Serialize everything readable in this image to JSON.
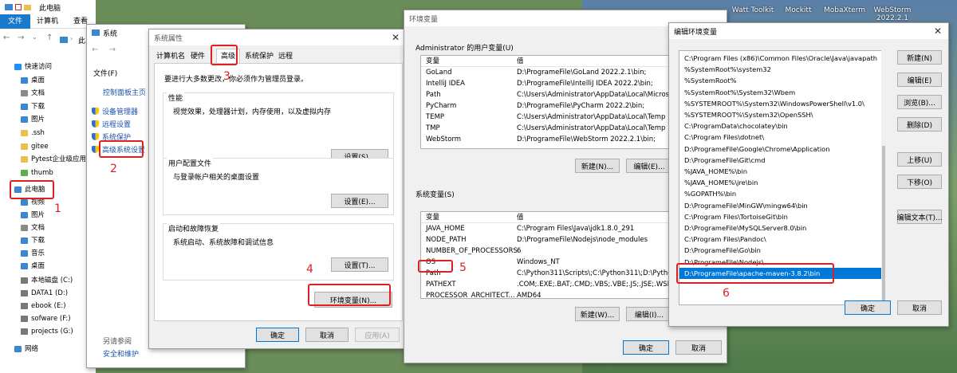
{
  "explorer": {
    "title": "此电脑",
    "ribbon_tabs": [
      "文件",
      "计算机",
      "查看"
    ],
    "nav_label": "此",
    "sidebar": [
      {
        "label": "快速访问",
        "icon": "star-icon",
        "color": "#1e90ff"
      },
      {
        "label": "桌面",
        "icon": "folder-icon",
        "color": "#3a86d0"
      },
      {
        "label": "文档",
        "icon": "document-icon",
        "color": "#8a8a8a"
      },
      {
        "label": "下载",
        "icon": "download-icon",
        "color": "#3a86d0"
      },
      {
        "label": "图片",
        "icon": "picture-icon",
        "color": "#3a86d0"
      },
      {
        "label": ".ssh",
        "icon": "folder-icon",
        "color": "#e8c04a"
      },
      {
        "label": "gitee",
        "icon": "folder-icon",
        "color": "#e8c04a"
      },
      {
        "label": "Pytest企业级应用实",
        "icon": "folder-icon",
        "color": "#e8c04a"
      },
      {
        "label": "thumb",
        "icon": "folder-icon",
        "color": "#5ab04a"
      },
      {
        "label": "此电脑",
        "icon": "computer-icon",
        "color": "#3a86d0"
      },
      {
        "label": "视频",
        "icon": "video-icon",
        "color": "#3a86d0"
      },
      {
        "label": "图片",
        "icon": "picture-icon",
        "color": "#3a86d0"
      },
      {
        "label": "文档",
        "icon": "document-icon",
        "color": "#8a8a8a"
      },
      {
        "label": "下载",
        "icon": "download-icon",
        "color": "#3a86d0"
      },
      {
        "label": "音乐",
        "icon": "music-icon",
        "color": "#3a86d0"
      },
      {
        "label": "桌面",
        "icon": "folder-icon",
        "color": "#3a86d0"
      },
      {
        "label": "本地磁盘 (C:)",
        "icon": "drive-icon",
        "color": "#777777"
      },
      {
        "label": "DATA1 (D:)",
        "icon": "drive-icon",
        "color": "#777777"
      },
      {
        "label": "ebook (E:)",
        "icon": "drive-icon",
        "color": "#777777"
      },
      {
        "label": "sofware (F:)",
        "icon": "drive-icon",
        "color": "#777777"
      },
      {
        "label": "projects (G:)",
        "icon": "drive-icon",
        "color": "#777777"
      },
      {
        "label": "网络",
        "icon": "network-icon",
        "color": "#3a86d0"
      }
    ]
  },
  "system": {
    "title": "系统",
    "menu": "文件(F)",
    "links": [
      "控制面板主页",
      "设备管理器",
      "远程设置",
      "系统保护",
      "高级系统设置"
    ],
    "see_also": "另请参阅",
    "security": "安全和维护"
  },
  "sysprops": {
    "title": "系统属性",
    "tabs": [
      "计算机名",
      "硬件",
      "高级",
      "系统保护",
      "远程"
    ],
    "admin_note": "要进行大多数更改，你必须作为管理员登录。",
    "perf_title": "性能",
    "perf_desc": "视觉效果，处理器计划，内存使用，以及虚拟内存",
    "perf_btn": "设置(S)...",
    "profile_title": "用户配置文件",
    "profile_desc": "与登录帐户相关的桌面设置",
    "profile_btn": "设置(E)...",
    "startup_title": "启动和故障恢复",
    "startup_desc": "系统启动、系统故障和调试信息",
    "startup_btn": "设置(T)...",
    "env_btn": "环境变量(N)...",
    "ok": "确定",
    "cancel": "取消",
    "apply": "应用(A)"
  },
  "envvars": {
    "title": "环境变量",
    "user_section": "Administrator 的用户变量(U)",
    "col_var": "变量",
    "col_val": "值",
    "user_vars": [
      {
        "name": "GoLand",
        "value": "D:\\ProgrameFile\\GoLand 2022.2.1\\bin;"
      },
      {
        "name": "IntelliJ IDEA",
        "value": "D:\\ProgrameFile\\IntelliJ IDEA 2022.2\\bin;"
      },
      {
        "name": "Path",
        "value": "C:\\Users\\Administrator\\AppData\\Local\\Microsoft\\"
      },
      {
        "name": "PyCharm",
        "value": "D:\\ProgrameFile\\PyCharm 2022.2\\bin;"
      },
      {
        "name": "TEMP",
        "value": "C:\\Users\\Administrator\\AppData\\Local\\Temp"
      },
      {
        "name": "TMP",
        "value": "C:\\Users\\Administrator\\AppData\\Local\\Temp"
      },
      {
        "name": "WebStorm",
        "value": "D:\\ProgrameFile\\WebStorm 2022.2.1\\bin;"
      }
    ],
    "user_new": "新建(N)...",
    "user_edit": "编辑(E)...",
    "sys_section": "系统变量(S)",
    "sys_vars": [
      {
        "name": "JAVA_HOME",
        "value": "C:\\Program Files\\Java\\jdk1.8.0_291"
      },
      {
        "name": "NODE_PATH",
        "value": "D:\\ProgrameFile\\Nodejs\\node_modules"
      },
      {
        "name": "NUMBER_OF_PROCESSORS",
        "value": "6"
      },
      {
        "name": "OS",
        "value": "Windows_NT"
      },
      {
        "name": "Path",
        "value": "C:\\Python311\\Scripts\\;C:\\Python311\\;D:\\Python36\\"
      },
      {
        "name": "PATHEXT",
        "value": ".COM;.EXE;.BAT;.CMD;.VBS;.VBE;.JS;.JSE;.WSF;.WSH"
      },
      {
        "name": "PROCESSOR_ARCHITECT...",
        "value": "AMD64"
      }
    ],
    "sys_new": "新建(W)...",
    "sys_edit": "编辑(I)...",
    "ok": "确定",
    "cancel": "取消"
  },
  "editenv": {
    "title": "编辑环境变量",
    "paths": [
      "C:\\Program Files (x86)\\Common Files\\Oracle\\Java\\javapath",
      "%SystemRoot%\\system32",
      "%SystemRoot%",
      "%SystemRoot%\\System32\\Wbem",
      "%SYSTEMROOT%\\System32\\WindowsPowerShell\\v1.0\\",
      "%SYSTEMROOT%\\System32\\OpenSSH\\",
      "C:\\ProgramData\\chocolatey\\bin",
      "C:\\Program Files\\dotnet\\",
      "D:\\ProgrameFile\\Google\\Chrome\\Application",
      "D:\\ProgrameFile\\Git\\cmd",
      "%JAVA_HOME%\\bin",
      "%JAVA_HOME%\\jre\\bin",
      "%GOPATH%\\bin",
      "D:\\ProgrameFile\\MinGW\\mingw64\\bin",
      "C:\\Program Files\\TortoiseGit\\bin",
      "D:\\ProgrameFile\\MySQLServer8.0\\bin",
      "C:\\Program Files\\Pandoc\\",
      "D:\\ProgrameFile\\Go\\bin",
      "D:\\ProgrameFile\\Nodejs\\",
      "D:\\ProgrameFile\\apache-maven-3.8.2\\bin"
    ],
    "selected_index": 19,
    "side_buttons": [
      "新建(N)",
      "编辑(E)",
      "浏览(B)...",
      "删除(D)",
      "上移(U)",
      "下移(O)",
      "编辑文本(T)..."
    ],
    "ok": "确定",
    "cancel": "取消"
  },
  "desktop": [
    "Watt Toolkit",
    "Mockitt",
    "MobaXterm",
    "WebStorm",
    "2022.2.1"
  ],
  "annotations": [
    "1",
    "2",
    "3",
    "4",
    "5",
    "6"
  ]
}
